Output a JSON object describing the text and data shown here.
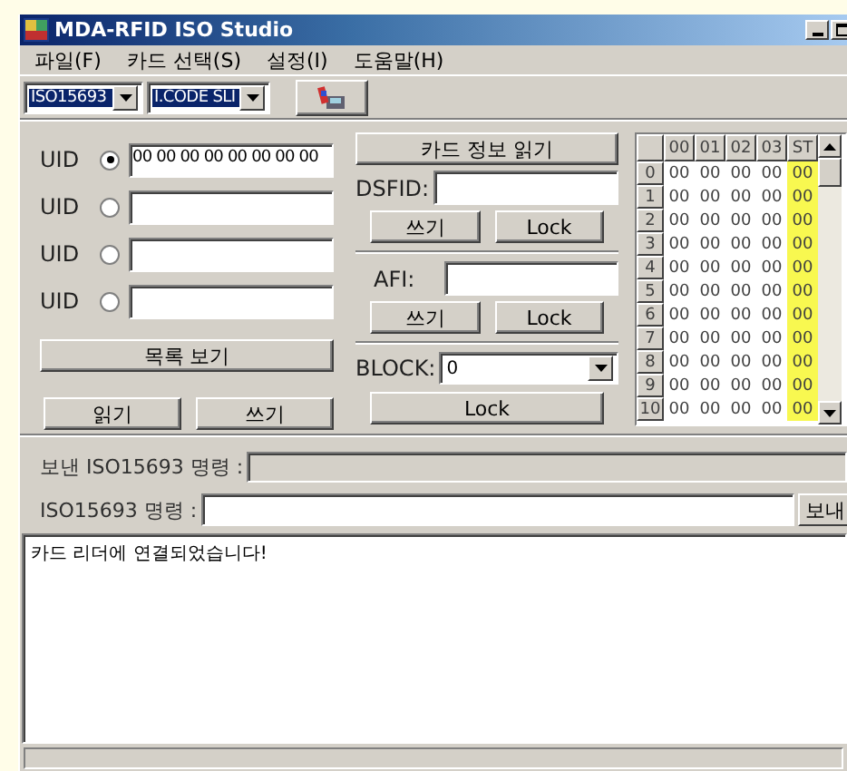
{
  "window": {
    "title": "MDA-RFID ISO Studio"
  },
  "menu": [
    {
      "label": "파일(F)"
    },
    {
      "label": "카드 선택(S)"
    },
    {
      "label": "설정(I)"
    },
    {
      "label": "도움말(H)"
    }
  ],
  "toolbar": {
    "protocol": "ISO15693",
    "card": "I.CODE SLI"
  },
  "uids": [
    {
      "label": "UID",
      "selected": true,
      "value": "00 00 00 00 00 00 00 00"
    },
    {
      "label": "UID",
      "selected": false
    },
    {
      "label": "UID",
      "selected": false
    },
    {
      "label": "UID",
      "selected": false
    }
  ],
  "uid_buttons": {
    "list": "목록 보기",
    "read": "읽기",
    "write": "쓰기"
  },
  "card_info": {
    "read_button": "카드 정보 읽기",
    "dsfid": {
      "label": "DSFID:",
      "write": "쓰기",
      "lock": "Lock"
    },
    "afi": {
      "label": "AFI:",
      "write": "쓰기",
      "lock": "Lock"
    },
    "block": {
      "label": "BLOCK:",
      "value": "0",
      "lock": "Lock"
    }
  },
  "block_table": {
    "columns": [
      "00",
      "01",
      "02",
      "03",
      "ST"
    ],
    "rows": [
      {
        "index": "0",
        "cells": [
          "00",
          "00",
          "00",
          "00",
          "00"
        ]
      },
      {
        "index": "1",
        "cells": [
          "00",
          "00",
          "00",
          "00",
          "00"
        ]
      },
      {
        "index": "2",
        "cells": [
          "00",
          "00",
          "00",
          "00",
          "00"
        ]
      },
      {
        "index": "3",
        "cells": [
          "00",
          "00",
          "00",
          "00",
          "00"
        ]
      },
      {
        "index": "4",
        "cells": [
          "00",
          "00",
          "00",
          "00",
          "00"
        ]
      },
      {
        "index": "5",
        "cells": [
          "00",
          "00",
          "00",
          "00",
          "00"
        ]
      },
      {
        "index": "6",
        "cells": [
          "00",
          "00",
          "00",
          "00",
          "00"
        ]
      },
      {
        "index": "7",
        "cells": [
          "00",
          "00",
          "00",
          "00",
          "00"
        ]
      },
      {
        "index": "8",
        "cells": [
          "00",
          "00",
          "00",
          "00",
          "00"
        ]
      },
      {
        "index": "9",
        "cells": [
          "00",
          "00",
          "00",
          "00",
          "00"
        ]
      },
      {
        "index": "10",
        "cells": [
          "00",
          "00",
          "00",
          "00",
          "00"
        ]
      }
    ]
  },
  "command": {
    "sent_label": "보낸 ISO15693 명령 :",
    "input_label": "ISO15693 명령 :",
    "send_button": "보내"
  },
  "log": {
    "text": "카드 리더에 연결되었습니다!"
  }
}
